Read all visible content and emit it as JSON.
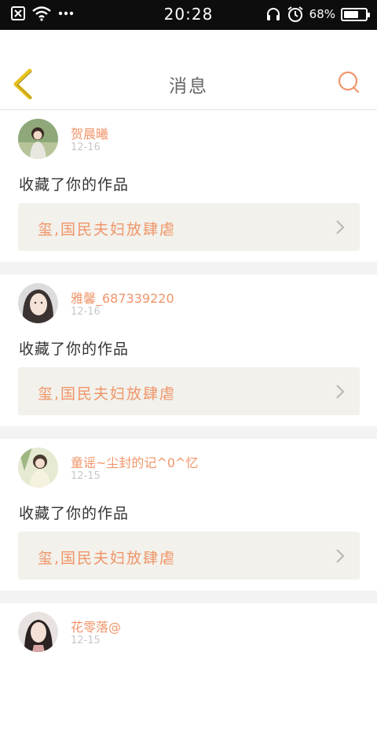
{
  "status_bar": {
    "time": "20:28",
    "battery_text": "68%",
    "battery_level": 0.68
  },
  "header": {
    "title": "消息"
  },
  "notifications": [
    {
      "username": "贺晨曦",
      "date": "12-16",
      "action": "收藏了你的作品",
      "work_title": "玺,国民夫妇放肆虐"
    },
    {
      "username": "雅馨_687339220",
      "date": "12-16",
      "action": "收藏了你的作品",
      "work_title": "玺,国民夫妇放肆虐"
    },
    {
      "username": "童谣~尘封的记^0^忆",
      "date": "12-15",
      "action": "收藏了你的作品",
      "work_title": "玺,国民夫妇放肆虐"
    },
    {
      "username": "花零落@",
      "date": "12-15"
    }
  ],
  "colors": {
    "accent": "#f0956a",
    "back_arrow": "#e8c21e",
    "work_box_bg": "#f2f1eb"
  },
  "icons": [
    "close-box-icon",
    "wifi-icon",
    "more-dots-icon",
    "headset-icon",
    "alarm-icon",
    "battery-icon",
    "back-arrow-icon",
    "search-icon",
    "chevron-right-icon"
  ]
}
